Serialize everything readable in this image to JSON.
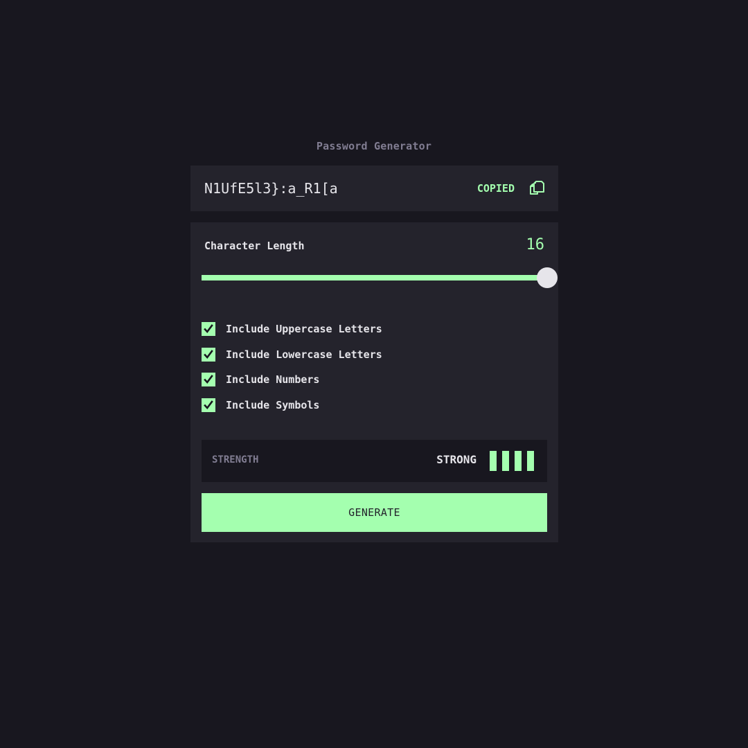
{
  "app": {
    "title": "Password Generator"
  },
  "output": {
    "password": "N1UfE5l3}:a_R1[a",
    "copied_label": "COPIED",
    "copy_icon": "copy-icon"
  },
  "length": {
    "label": "Character Length",
    "value": "16",
    "min": 0,
    "max": 16,
    "fraction": 1.0
  },
  "options": [
    {
      "label": "Include Uppercase Letters",
      "checked": true
    },
    {
      "label": "Include Lowercase Letters",
      "checked": true
    },
    {
      "label": "Include Numbers",
      "checked": true
    },
    {
      "label": "Include Symbols",
      "checked": true
    }
  ],
  "strength": {
    "label": "STRENGTH",
    "value": "STRONG",
    "level": 4,
    "max_level": 4
  },
  "generate": {
    "label": "GENERATE"
  },
  "colors": {
    "background": "#18171f",
    "panel": "#24232c",
    "accent": "#a4ffaf",
    "text": "#e6e5ea",
    "muted": "#817d92"
  }
}
